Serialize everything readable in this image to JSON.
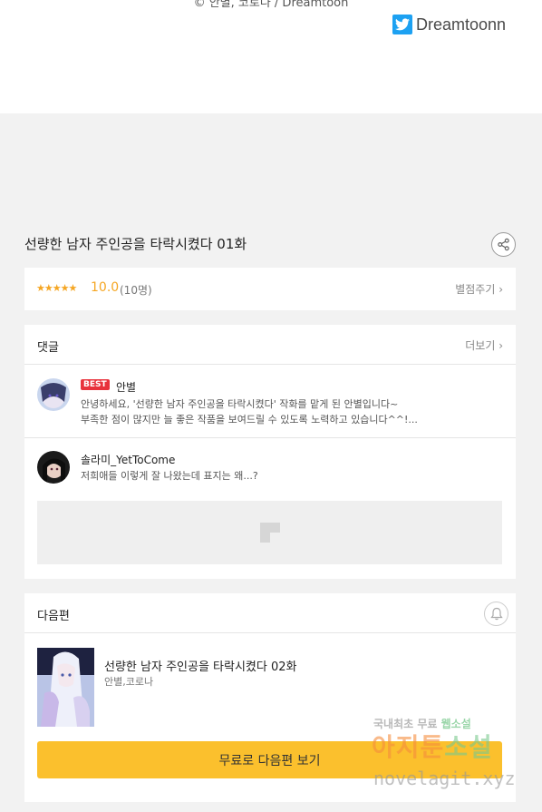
{
  "top": {
    "copyright": "© 안별, 코로나 / Dreamtoon",
    "twitter_handle": "Dreamtoonn"
  },
  "episode": {
    "title": "선량한 남자 주인공을 타락시켰다 01화"
  },
  "rating": {
    "stars": "★★★★★",
    "score": "10.0",
    "count": "(10명)",
    "rate_link": "별점주기 ›"
  },
  "comments": {
    "header": "댓글",
    "more": "더보기 ›",
    "items": [
      {
        "badge": "BEST",
        "author": "안별",
        "line1": "안녕하세요, '선량한 남자 주인공을 타락시켰다' 작화를 맡게 된 안별입니다~",
        "line2": "부족한 점이 많지만 늘 좋은 작품을 보여드릴 수 있도록 노력하고 있습니다^^!..."
      },
      {
        "author": "솔라미_YetToCome",
        "line1": "저희애들 이렇게 잘 나왔는데 표지는 왜...?"
      }
    ]
  },
  "next": {
    "header": "다음편",
    "episode_title": "선량한 남자 주인공을 타락시켰다 02화",
    "author": "안별,코로나",
    "button": "무료로 다음편 보기"
  },
  "watermark": {
    "line1a": "국내최초 무료",
    "line1b": "웹소설",
    "line2a": "아지툰",
    "line2b": "소설",
    "line3": "novelagit.xyz"
  },
  "colors": {
    "accent_yellow": "#fbc02d",
    "star_orange": "#f5a623",
    "best_red": "#e8323c",
    "twitter_blue": "#1da1f2"
  },
  "icons": [
    "twitter-icon",
    "share-icon",
    "chevron-right-icon",
    "image-placeholder-icon",
    "bell-icon"
  ]
}
